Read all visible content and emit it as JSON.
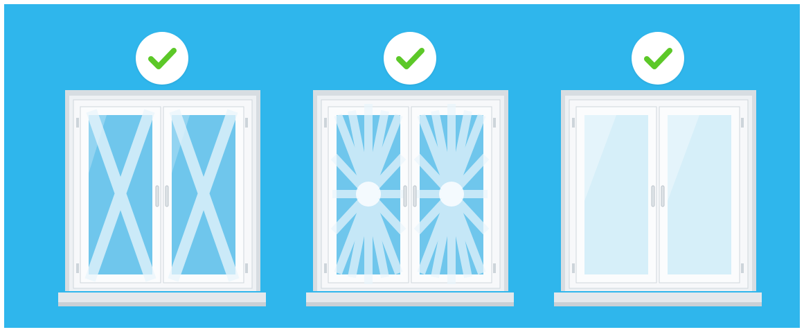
{
  "scene": {
    "background_color": "#2fb6ec",
    "panels": [
      {
        "id": "left",
        "icon": "check-icon",
        "tape_pattern": "x-crosses"
      },
      {
        "id": "middle",
        "icon": "check-icon",
        "tape_pattern": "starburst"
      },
      {
        "id": "right",
        "icon": "check-icon",
        "tape_pattern": "protective-film"
      }
    ]
  },
  "colors": {
    "check_green": "#5cc828",
    "badge_white": "#ffffff",
    "frame_white": "#f4f6f8",
    "glass_blue": "#6fc6ec",
    "tape_white": "#eaf6fc"
  }
}
